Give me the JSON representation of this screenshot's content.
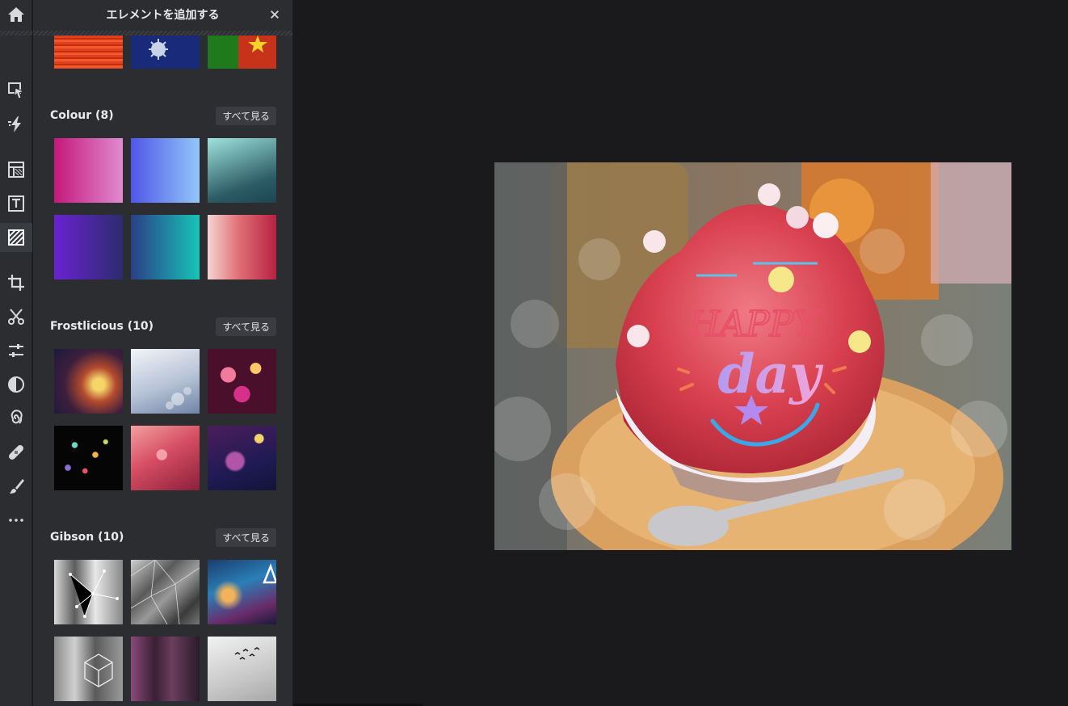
{
  "panel": {
    "title": "エレメントを追加する",
    "see_all_label": "すべて見る"
  },
  "rail": {
    "items": [
      "home-icon",
      "select-icon",
      "quick-fix-icon",
      "layout-icon",
      "text-icon",
      "texture-icon",
      "crop-icon",
      "cut-icon",
      "adjust-icon",
      "contrast-icon",
      "swirl-icon",
      "bandage-icon",
      "brush-icon",
      "more-icon"
    ],
    "active": "texture-icon"
  },
  "sections": [
    {
      "title": "Colour (8)"
    },
    {
      "title": "Frostlicious (10)"
    },
    {
      "title": "Gibson (10)"
    }
  ],
  "canvas": {
    "overlay_text_1": "HAPPY",
    "overlay_text_2": "day"
  },
  "colors": {
    "rail_bg": "#2b2d31",
    "canvas_bg": "#1a1a1c",
    "text": "#e9eaec"
  }
}
